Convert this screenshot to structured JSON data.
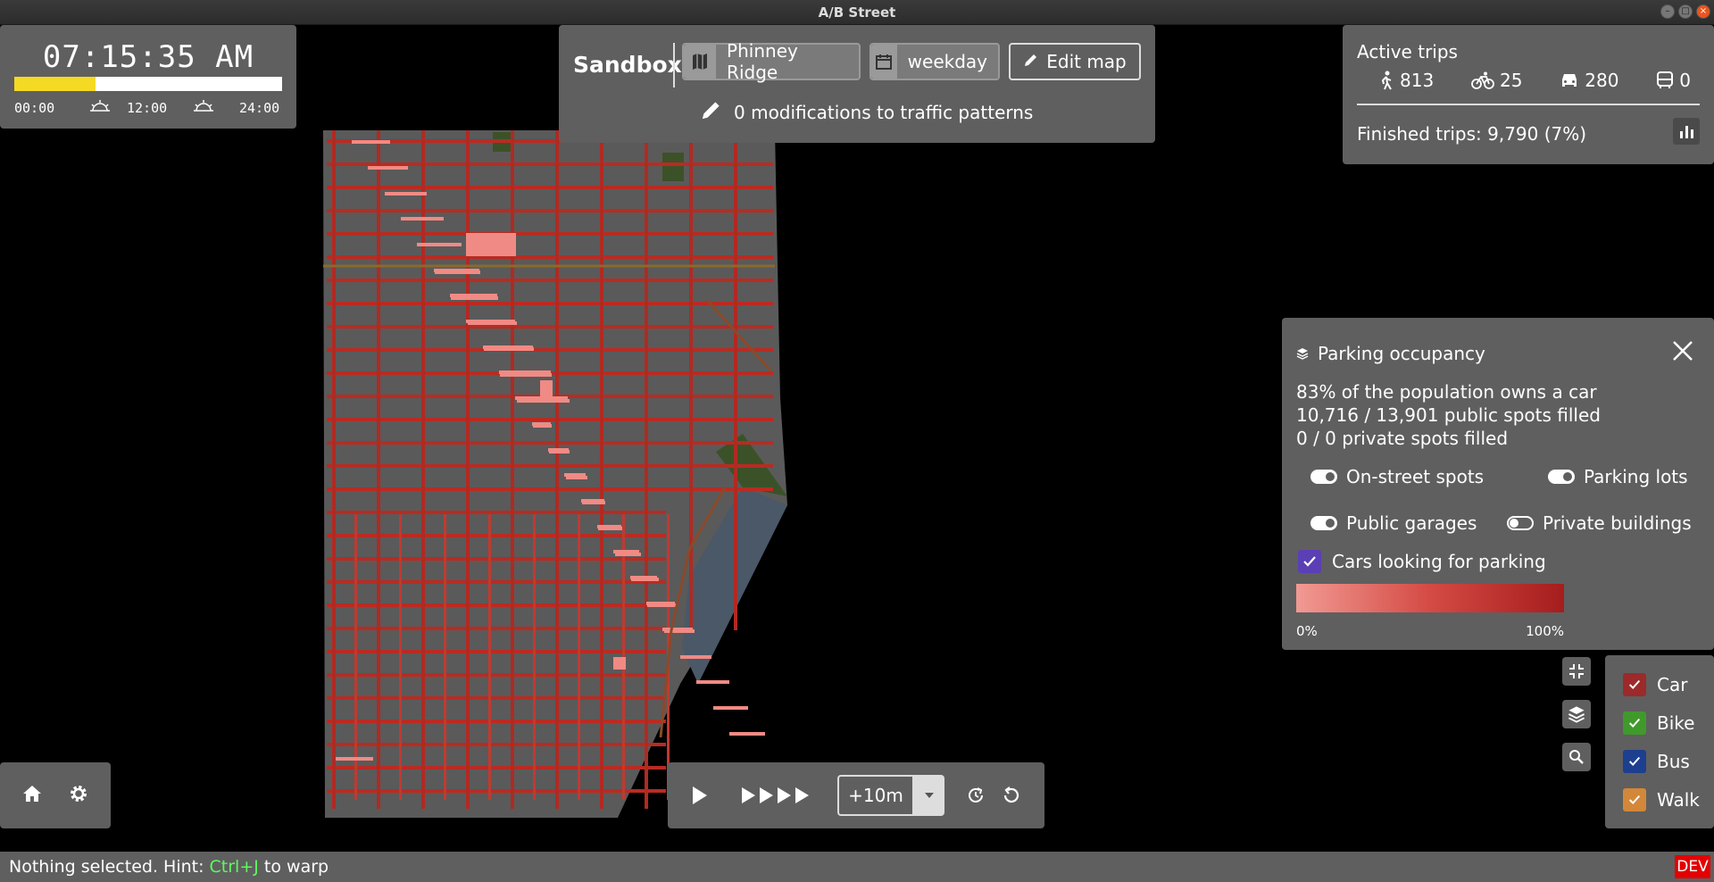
{
  "window": {
    "title": "A/B Street"
  },
  "clock": {
    "time": "07:15:35 AM",
    "progress_fraction": 0.302,
    "marks": [
      "00:00",
      "12:00",
      "24:00"
    ],
    "bar_color": "#f4da22"
  },
  "top_center": {
    "mode_title": "Sandbox",
    "map_button": {
      "icon": "map-icon",
      "label": "Phinney Ridge"
    },
    "scenario_button": {
      "icon": "calendar-icon",
      "label": "weekday"
    },
    "edit_button": {
      "icon": "pencil-icon",
      "label": "Edit map"
    },
    "modifications_text": "0 modifications to traffic patterns"
  },
  "active_trips": {
    "header": "Active trips",
    "counts": [
      {
        "icon": "walk-icon",
        "value": "813"
      },
      {
        "icon": "bike-icon",
        "value": "25"
      },
      {
        "icon": "car-icon",
        "value": "280"
      },
      {
        "icon": "bus-icon",
        "value": "0"
      }
    ],
    "finished": "Finished trips: 9,790 (7%)"
  },
  "parking": {
    "title": "Parking occupancy",
    "lines": [
      "83% of the population owns a car",
      "10,716 / 13,901 public spots filled",
      "0 / 0 private spots filled"
    ],
    "toggles": [
      {
        "label": "On-street spots",
        "state": "on"
      },
      {
        "label": "Parking lots",
        "state": "on"
      },
      {
        "label": "Public garages",
        "state": "on"
      },
      {
        "label": "Private buildings",
        "state": "off"
      }
    ],
    "checkbox": {
      "label": "Cars looking for parking",
      "checked": true,
      "color": "#5b3fb5"
    },
    "scale_min": "0%",
    "scale_max": "100%"
  },
  "legend": {
    "items": [
      {
        "label": "Car",
        "color": "#9c2a2a",
        "checked": true
      },
      {
        "label": "Bike",
        "color": "#3f9a2b",
        "checked": true
      },
      {
        "label": "Bus",
        "color": "#1d3f8f",
        "checked": true
      },
      {
        "label": "Walk",
        "color": "#d2873a",
        "checked": true
      }
    ]
  },
  "speed": {
    "step_value": "+10m"
  },
  "status_bar": {
    "prefix": "Nothing selected. Hint: ",
    "key": "Ctrl+J",
    "suffix": " to warp",
    "dev_badge": "DEV"
  }
}
